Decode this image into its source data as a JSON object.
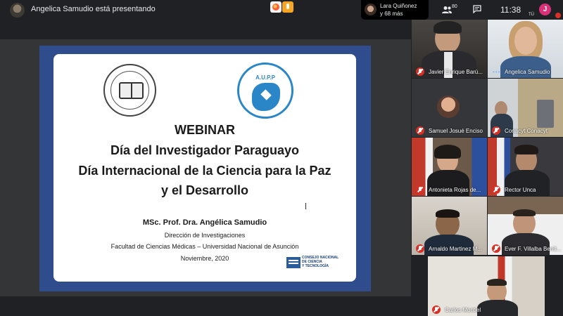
{
  "header": {
    "presenter_text": "Angelica Samudio está presentando"
  },
  "notification": {
    "name": "Lara Quiñonez",
    "more": "y 68 más"
  },
  "controls": {
    "people_count": "80",
    "time": "11:38",
    "user_initial": "J",
    "you_label": "TÚ"
  },
  "slide": {
    "title_1": "WEBINAR",
    "title_2": "Día del Investigador Paraguayo",
    "title_3": "Día Internacional de la Ciencia para la Paz",
    "title_4": "y el Desarrollo",
    "author": "MSc. Prof. Dra. Angélica Samudio",
    "line_1": "Dirección de Investigaciones",
    "line_2": "Facultad de Ciencias Médicas – Universidad Nacional de Asunción",
    "date": "Noviembre, 2020",
    "aupp_label": "A.U.P.P",
    "conacyt_label": "CONSEJO NACIONAL\nDE CIENCIA\nY TECNOLOGÍA"
  },
  "participants": [
    {
      "name": "Javier Enrique Barú..."
    },
    {
      "name": "Angelica Samudio"
    },
    {
      "name": "Samuel Josué Enciso"
    },
    {
      "name": "Conacyt Conacyt"
    },
    {
      "name": "Antonieta Rojas de..."
    },
    {
      "name": "Rector Unca"
    },
    {
      "name": "Arnaldo Martinez M..."
    },
    {
      "name": "Ever F. Villalba Benít..."
    },
    {
      "name": "Carlos Montiel"
    }
  ],
  "colors": {
    "background": "#202124",
    "slide_frame": "#2f4c8c",
    "mic_muted": "#d93025",
    "user_avatar": "#d93077"
  }
}
